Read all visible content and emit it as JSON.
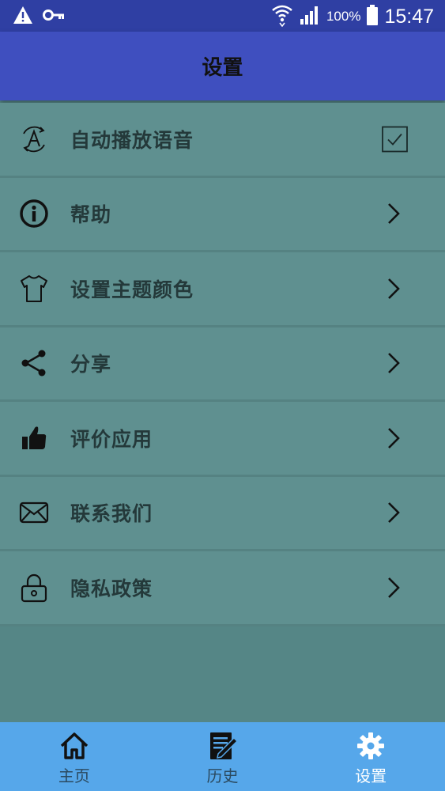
{
  "status_bar": {
    "battery_percent": "100%",
    "time": "15:47",
    "icons": [
      "warning-icon",
      "key-icon",
      "wifi-icon",
      "signal-icon",
      "battery-icon"
    ]
  },
  "app_bar": {
    "title": "设置"
  },
  "settings": [
    {
      "label": "自动播放语音",
      "icon": "auto-play-icon",
      "control": "checkbox",
      "checked": true
    },
    {
      "label": "帮助",
      "icon": "info-icon",
      "control": "chevron"
    },
    {
      "label": "设置主题颜色",
      "icon": "tshirt-icon",
      "control": "chevron"
    },
    {
      "label": "分享",
      "icon": "share-icon",
      "control": "chevron"
    },
    {
      "label": "评价应用",
      "icon": "thumbs-up-icon",
      "control": "chevron"
    },
    {
      "label": "联系我们",
      "icon": "envelope-icon",
      "control": "chevron"
    },
    {
      "label": "隐私政策",
      "icon": "lock-icon",
      "control": "chevron"
    }
  ],
  "bottom_nav": {
    "items": [
      {
        "label": "主页",
        "icon": "home-icon",
        "active": false
      },
      {
        "label": "历史",
        "icon": "history-icon",
        "active": false
      },
      {
        "label": "设置",
        "icon": "gear-icon",
        "active": true
      }
    ]
  },
  "colors": {
    "status_bar": "#2f3fa3",
    "app_bar": "#3f4fbf",
    "background": "#558686",
    "row": "#5f9090",
    "bottom_nav": "#56a7ea"
  }
}
